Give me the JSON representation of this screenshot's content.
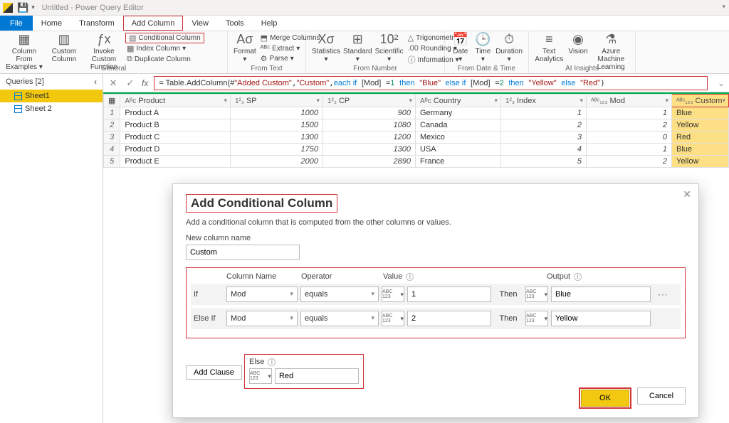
{
  "title": "Untitled - Power Query Editor",
  "menubar": {
    "file": "File",
    "items": [
      "Home",
      "Transform",
      "Add Column",
      "View",
      "Tools",
      "Help"
    ],
    "selected": "Add Column"
  },
  "ribbon": {
    "general": {
      "label": "General",
      "col_from_examples": "Column From Examples",
      "custom_column": "Custom Column",
      "invoke": "Invoke Custom Function",
      "conditional": "Conditional Column",
      "index": "Index Column",
      "duplicate": "Duplicate Column"
    },
    "from_text": {
      "label": "From Text",
      "format": "Format",
      "extract": "Extract",
      "parse": "Parse"
    },
    "from_number": {
      "label": "From Number",
      "statistics": "Statistics",
      "standard": "Standard",
      "scientific": "Scientific",
      "trig": "Trigonometry",
      "rounding": "Rounding",
      "info": "Information"
    },
    "from_dt": {
      "label": "From Date & Time",
      "date": "Date",
      "time": "Time",
      "duration": "Duration"
    },
    "ai": {
      "label": "AI Insights",
      "text": "Text Analytics",
      "vision": "Vision",
      "aml": "Azure Machine Learning"
    }
  },
  "queries": {
    "header": "Queries [2]",
    "items": [
      "Sheet1",
      "Sheet 2"
    ],
    "selected": "Sheet1"
  },
  "formula": {
    "prefix": "= Table.AddColumn(#",
    "added": "\"Added Custom\"",
    "custom": "\"Custom\"",
    "each": "each if",
    "mod": "[Mod]",
    "eq1": "= ",
    "one": "1",
    "then": "then",
    "blue": "\"Blue\"",
    "elseif": "else if",
    "two": "2",
    "yellow": "\"Yellow\"",
    "else": "else",
    "red": "\"Red\""
  },
  "grid": {
    "columns": [
      "Product",
      "SP",
      "CP",
      "Country",
      "Index",
      "Mod",
      "Custom"
    ],
    "rows": [
      {
        "n": "1",
        "Product": "Product A",
        "SP": "1000",
        "CP": "900",
        "Country": "Germany",
        "Index": "1",
        "Mod": "1",
        "Custom": "Blue"
      },
      {
        "n": "2",
        "Product": "Product B",
        "SP": "1500",
        "CP": "1080",
        "Country": "Canada",
        "Index": "2",
        "Mod": "2",
        "Custom": "Yellow"
      },
      {
        "n": "3",
        "Product": "Product C",
        "SP": "1300",
        "CP": "1200",
        "Country": "Mexico",
        "Index": "3",
        "Mod": "0",
        "Custom": "Red"
      },
      {
        "n": "4",
        "Product": "Product D",
        "SP": "1750",
        "CP": "1300",
        "Country": "USA",
        "Index": "4",
        "Mod": "1",
        "Custom": "Blue"
      },
      {
        "n": "5",
        "Product": "Product E",
        "SP": "2000",
        "CP": "2890",
        "Country": "France",
        "Index": "5",
        "Mod": "2",
        "Custom": "Yellow"
      }
    ]
  },
  "dialog": {
    "title": "Add Conditional Column",
    "desc": "Add a conditional column that is computed from the other columns or values.",
    "newcol_label": "New column name",
    "newcol_value": "Custom",
    "hdr": {
      "col": "Column Name",
      "op": "Operator",
      "val": "Value",
      "out": "Output"
    },
    "rows": [
      {
        "kw": "If",
        "col": "Mod",
        "op": "equals",
        "val": "1",
        "out": "Blue",
        "then": "Then"
      },
      {
        "kw": "Else If",
        "col": "Mod",
        "op": "equals",
        "val": "2",
        "out": "Yellow",
        "then": "Then"
      }
    ],
    "add_clause": "Add Clause",
    "else_label": "Else",
    "else_value": "Red",
    "ok": "OK",
    "cancel": "Cancel",
    "type_label": "ABC 123"
  }
}
